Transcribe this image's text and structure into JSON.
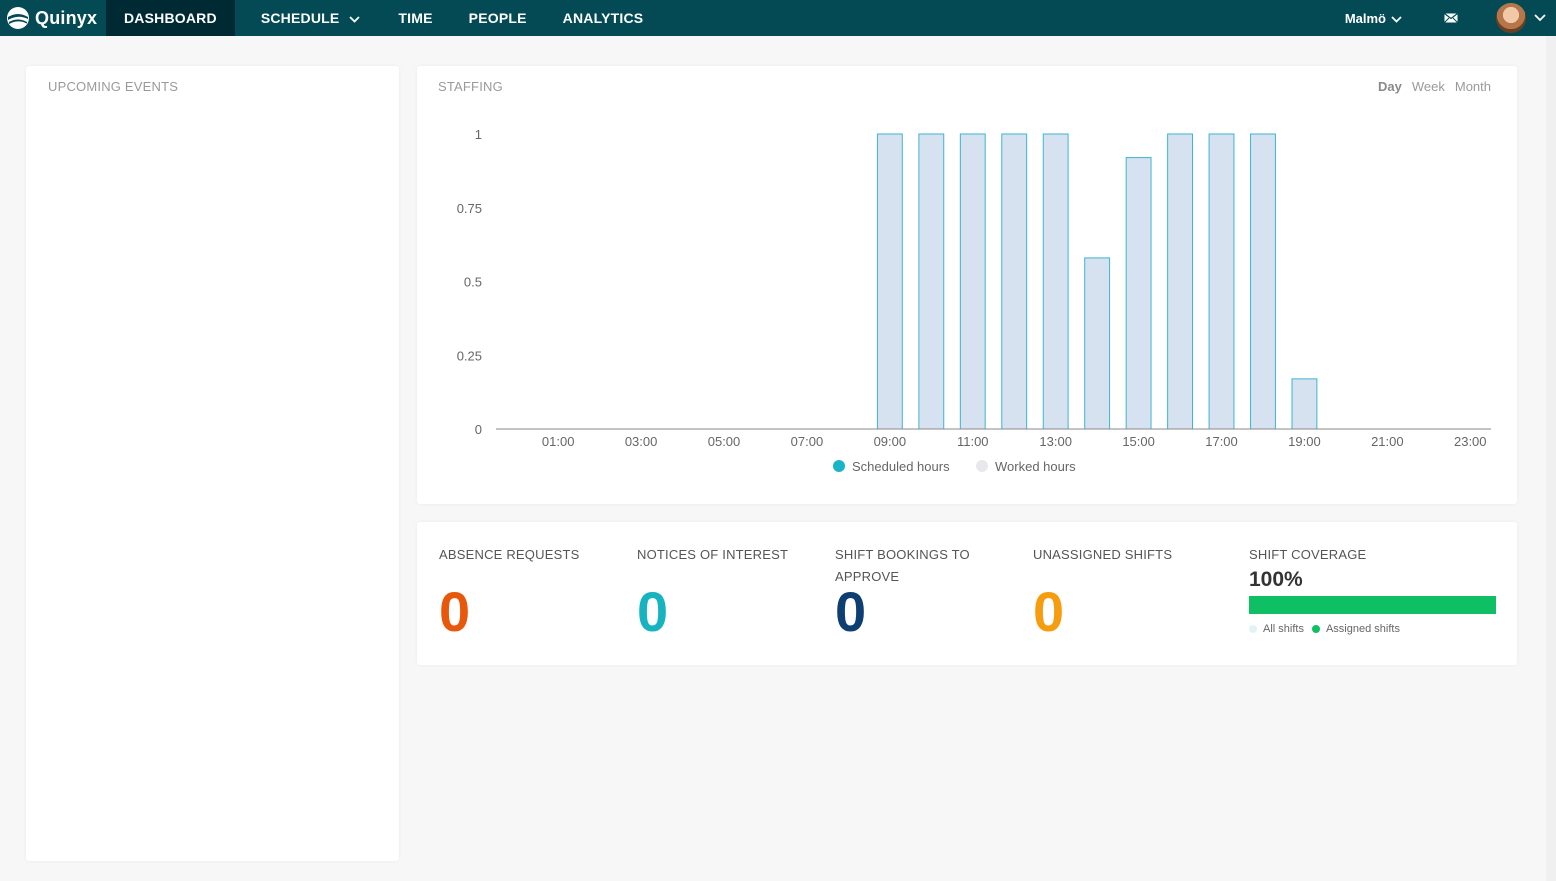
{
  "nav": {
    "logo_text": "Quinyx",
    "items": [
      {
        "label": "DASHBOARD"
      },
      {
        "label": "SCHEDULE"
      },
      {
        "label": "TIME"
      },
      {
        "label": "PEOPLE"
      },
      {
        "label": "ANALYTICS"
      }
    ],
    "location": "Malmö",
    "icons": [
      "quinyx-logo-icon",
      "chevron-down-icon",
      "mail-icon",
      "avatar"
    ]
  },
  "events": {
    "title": "UPCOMING EVENTS"
  },
  "staffing": {
    "title": "STAFFING",
    "ranges": [
      "Day",
      "Week",
      "Month"
    ],
    "selected_range": "Day"
  },
  "chart_data": {
    "type": "bar",
    "x_tick_labels": [
      "01:00",
      "03:00",
      "05:00",
      "07:00",
      "09:00",
      "11:00",
      "13:00",
      "15:00",
      "17:00",
      "19:00",
      "21:00",
      "23:00"
    ],
    "categories": [
      "00:00",
      "01:00",
      "02:00",
      "03:00",
      "04:00",
      "05:00",
      "06:00",
      "07:00",
      "08:00",
      "09:00",
      "10:00",
      "11:00",
      "12:00",
      "13:00",
      "14:00",
      "15:00",
      "16:00",
      "17:00",
      "18:00",
      "19:00",
      "20:00",
      "21:00",
      "22:00",
      "23:00"
    ],
    "series": [
      {
        "name": "Scheduled hours",
        "color": "#1ab3c7",
        "values": [
          0,
          0,
          0,
          0,
          0,
          0,
          0,
          0,
          0,
          1,
          1,
          1,
          1,
          1,
          0.58,
          0.92,
          1,
          1,
          1,
          0.17,
          0,
          0,
          0,
          0
        ]
      },
      {
        "name": "Worked hours",
        "color": "#e6e8ec",
        "values": [
          0,
          0,
          0,
          0,
          0,
          0,
          0,
          0,
          0,
          0,
          0,
          0,
          0,
          0,
          0,
          0,
          0,
          0,
          0,
          0,
          0,
          0,
          0,
          0
        ]
      }
    ],
    "y_ticks": [
      {
        "value": 0,
        "label": "0"
      },
      {
        "value": 0.25,
        "label": "0.25"
      },
      {
        "value": 0.5,
        "label": "0.5"
      },
      {
        "value": 0.75,
        "label": "0.75"
      },
      {
        "value": 1,
        "label": "1"
      }
    ],
    "ylim": [
      0,
      1
    ],
    "bar_fill": "#d6e2ef",
    "bar_stroke": "#3bb6d0",
    "legend_position": "bottom-center"
  },
  "stats": [
    {
      "label_lines": [
        "ABSENCE REQUESTS"
      ],
      "value": "0",
      "color": "#e8580c"
    },
    {
      "label_lines": [
        "NOTICES OF INTEREST"
      ],
      "value": "0",
      "color": "#17b3c1"
    },
    {
      "label_lines": [
        "SHIFT BOOKINGS TO",
        "APPROVE"
      ],
      "value": "0",
      "color": "#0e3f73"
    },
    {
      "label_lines": [
        "UNASSIGNED SHIFTS"
      ],
      "value": "0",
      "color": "#f59d0f"
    }
  ],
  "coverage": {
    "title": "SHIFT COVERAGE",
    "percent_text": "100%",
    "fraction": 1.0,
    "legend": [
      {
        "label": "All shifts",
        "color": "#e3f3f5"
      },
      {
        "label": "Assigned shifts",
        "color": "#0fbf63"
      }
    ]
  }
}
